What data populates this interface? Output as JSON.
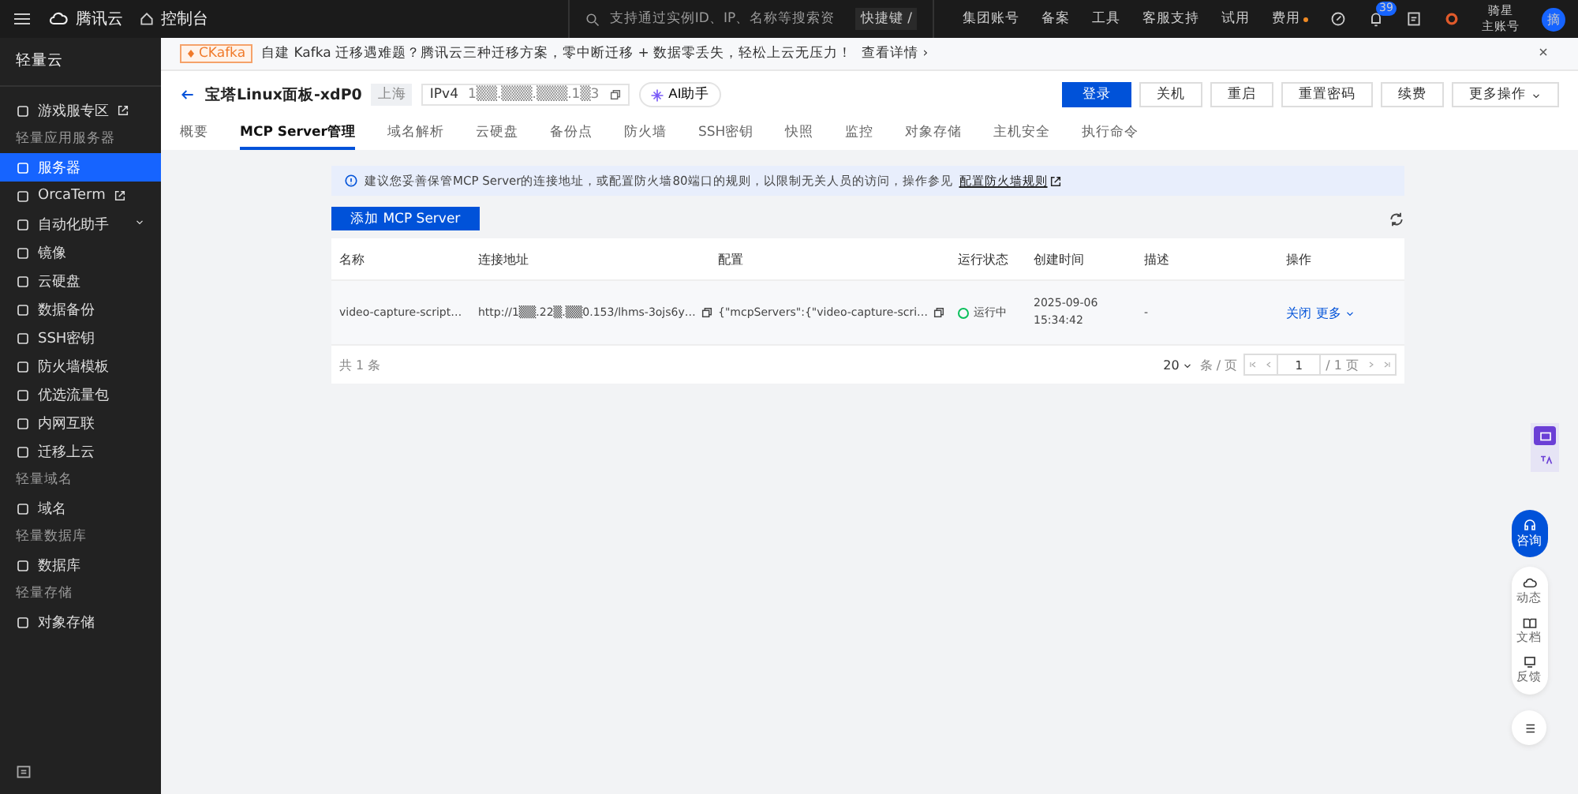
{
  "topbar": {
    "brand": "腾讯云",
    "console": "控制台",
    "search": {
      "placeholder": "支持通过实例ID、IP、名称等搜索资"
    },
    "shortcut": "快捷键 /",
    "nav": [
      {
        "label": "集团账号",
        "dot": false
      },
      {
        "label": "备案",
        "dot": false
      },
      {
        "label": "工具",
        "dot": false
      },
      {
        "label": "客服支持",
        "dot": false
      },
      {
        "label": "试用",
        "dot": false
      },
      {
        "label": "费用",
        "dot": true
      }
    ],
    "notify_count": "39",
    "account": [
      "骑星",
      "主账号"
    ],
    "avatar": "摘"
  },
  "sidebar": {
    "title": "轻量云",
    "items": [
      {
        "kind": "item",
        "label": "游戏服专区",
        "external": true,
        "chevron": false,
        "selected": false
      },
      {
        "kind": "section",
        "label": "轻量应用服务器"
      },
      {
        "kind": "item",
        "label": "服务器",
        "external": false,
        "chevron": false,
        "selected": true
      },
      {
        "kind": "item",
        "label": "OrcaTerm",
        "external": true,
        "chevron": false,
        "selected": false
      },
      {
        "kind": "item",
        "label": "自动化助手",
        "external": false,
        "chevron": true,
        "selected": false
      },
      {
        "kind": "item",
        "label": "镜像",
        "external": false,
        "chevron": false,
        "selected": false
      },
      {
        "kind": "item",
        "label": "云硬盘",
        "external": false,
        "chevron": false,
        "selected": false
      },
      {
        "kind": "item",
        "label": "数据备份",
        "external": false,
        "chevron": false,
        "selected": false
      },
      {
        "kind": "item",
        "label": "SSH密钥",
        "external": false,
        "chevron": false,
        "selected": false
      },
      {
        "kind": "item",
        "label": "防火墙模板",
        "external": false,
        "chevron": false,
        "selected": false
      },
      {
        "kind": "item",
        "label": "优选流量包",
        "external": false,
        "chevron": false,
        "selected": false
      },
      {
        "kind": "item",
        "label": "内网互联",
        "external": false,
        "chevron": false,
        "selected": false
      },
      {
        "kind": "item",
        "label": "迁移上云",
        "external": false,
        "chevron": false,
        "selected": false
      },
      {
        "kind": "section",
        "label": "轻量域名"
      },
      {
        "kind": "item",
        "label": "域名",
        "external": false,
        "chevron": false,
        "selected": false
      },
      {
        "kind": "section",
        "label": "轻量数据库"
      },
      {
        "kind": "item",
        "label": "数据库",
        "external": false,
        "chevron": false,
        "selected": false
      },
      {
        "kind": "section",
        "label": "轻量存储"
      },
      {
        "kind": "item",
        "label": "对象存储",
        "external": false,
        "chevron": false,
        "selected": false
      }
    ]
  },
  "banner": {
    "tag": "CKafka",
    "tag_icon": true,
    "text": "自建 Kafka 迁移遇难题？腾讯云三种迁移方案，零中断迁移 + 数据零丢失，轻松上云无压力！",
    "link": "查看详情 ›"
  },
  "instance": {
    "name": "宝塔Linux面板-xdP0",
    "region": "上海",
    "ip_label": "IPv4",
    "ip": "1▒▒.▒▒▒.▒▒▒.1▒3",
    "ai": "AI助手"
  },
  "actions": [
    {
      "label": "登录",
      "primary": true
    },
    {
      "label": "关机",
      "primary": false
    },
    {
      "label": "重启",
      "primary": false
    },
    {
      "label": "重置密码",
      "primary": false
    },
    {
      "label": "续费",
      "primary": false
    },
    {
      "label": "更多操作",
      "primary": false
    }
  ],
  "tabs": [
    {
      "label": "概要",
      "selected": false
    },
    {
      "label": "MCP Server管理",
      "selected": true
    },
    {
      "label": "域名解析",
      "selected": false
    },
    {
      "label": "云硬盘",
      "selected": false
    },
    {
      "label": "备份点",
      "selected": false
    },
    {
      "label": "防火墙",
      "selected": false
    },
    {
      "label": "SSH密钥",
      "selected": false
    },
    {
      "label": "快照",
      "selected": false
    },
    {
      "label": "监控",
      "selected": false
    },
    {
      "label": "对象存储",
      "selected": false
    },
    {
      "label": "主机安全",
      "selected": false
    },
    {
      "label": "执行命令",
      "selected": false
    }
  ],
  "notice": {
    "text": "建议您妥善保管MCP Server的连接地址，或配置防火墙80端口的规则，以限制无关人员的访问，操作参见",
    "link": "配置防火墙规则"
  },
  "add_button": "添加 MCP Server",
  "table": {
    "columns": [
      "名称",
      "连接地址",
      "配置",
      "运行状态",
      "创建时间",
      "描述",
      "操作"
    ],
    "rows": [
      {
        "name": "video-capture-script…",
        "address": "http://1▒▒.22▒.▒▒0.153/lhms-3ojs6y…",
        "config": "{\"mcpServers\":{\"video-capture-scri…",
        "status": "运行中",
        "created": [
          "2025-09-06",
          "15:34:42"
        ],
        "description": "-",
        "actions": [
          "关闭",
          "更多"
        ]
      }
    ]
  },
  "footer": {
    "total": "共 1 条",
    "page_size": "20",
    "per_page": "条 / 页",
    "page": "1",
    "pages": "/ 1 页"
  },
  "float": {
    "consult": "咨询",
    "items": [
      "动态",
      "文档",
      "反馈"
    ]
  }
}
